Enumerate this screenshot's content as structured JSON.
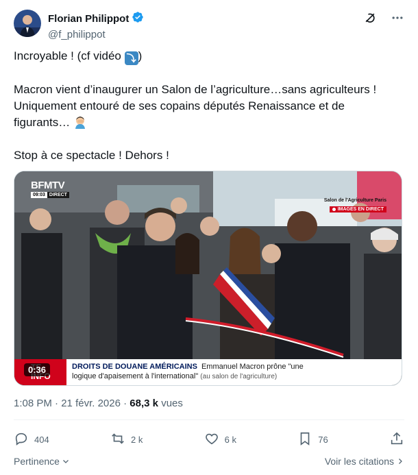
{
  "author": {
    "name": "Florian Philippot",
    "handle": "@f_philippot"
  },
  "tweet": {
    "line1_text": "Incroyable ! (cf vidéo ",
    "line1_end": ")",
    "line2": "Macron vient d’inaugurer un Salon de l’agriculture…sans agriculteurs !",
    "line3": "Uniquement entouré de ses copains députés Renaissance et de",
    "line4": "figurants… ",
    "line5": "Stop à ce spectacle ! Dehors !"
  },
  "video": {
    "channel": "BFMTV",
    "clock": "09:03",
    "clock_tag": "DIRECT",
    "location": "Salon de l'Agriculture Paris",
    "live_label": "IMAGES EN DIRECT",
    "ticker_tag_line1": "TE",
    "ticker_tag_line2": "INFO",
    "headline": "DROITS DE DOUANE AMÉRICAINS",
    "subline_a": "Emmanuel Macron prône \"une",
    "subline_b": "logique d'apaisement à l'international\"",
    "subline_c": "(au salon de l'agriculture)",
    "duration": "0:36"
  },
  "meta": {
    "time": "1:08 PM",
    "separator": "·",
    "date": "21 févr. 2026",
    "views_count": "68,3 k",
    "views_label": "vues"
  },
  "stats": {
    "replies": "404",
    "reposts": "2 k",
    "likes": "6 k",
    "bookmarks": "76"
  },
  "footer": {
    "sort_label": "Pertinence",
    "quotes_label": "Voir les citations"
  },
  "colors": {
    "verified": "#1d9bf0",
    "muted_text": "#536471",
    "border": "#cfd9de",
    "bfm_red": "#d0021b"
  },
  "icons": {
    "verified": "verified-badge-icon",
    "grok": "grok-icon",
    "more": "more-icon",
    "reply": "reply-icon",
    "repost": "repost-icon",
    "like": "heart-icon",
    "bookmark": "bookmark-icon",
    "share": "share-icon"
  }
}
